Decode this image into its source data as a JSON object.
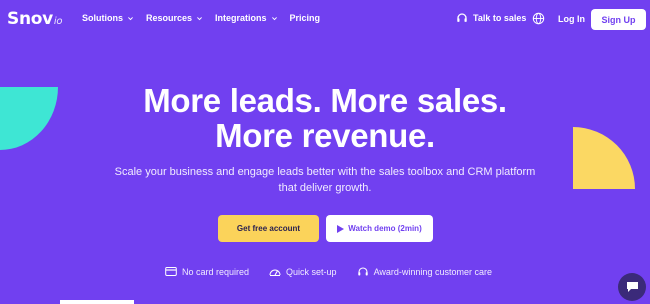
{
  "nav": {
    "logo": "Snov",
    "logo_suffix": "io",
    "menu": [
      {
        "label": "Solutions"
      },
      {
        "label": "Resources"
      },
      {
        "label": "Integrations"
      },
      {
        "label": "Pricing"
      }
    ],
    "talk_to_sales": "Talk to sales",
    "login": "Log In",
    "signup": "Sign Up"
  },
  "hero": {
    "headline_line1": "More leads. More sales.",
    "headline_line2": "More revenue.",
    "subhead_line1": "Scale your business and engage leads better with the sales toolbox and CRM platform",
    "subhead_line2": "that deliver growth.",
    "cta_primary": "Get free account",
    "cta_secondary": "Watch demo (2min)"
  },
  "features": [
    {
      "label": "No card required",
      "icon": "card-icon"
    },
    {
      "label": "Quick set-up",
      "icon": "speedometer-icon"
    },
    {
      "label": "Award-winning customer care",
      "icon": "headset-icon"
    }
  ],
  "colors": {
    "background": "#7140f0",
    "accent_yellow": "#fbd35a",
    "accent_teal": "#3ee6d4",
    "chat_bg": "#3b2a7a"
  }
}
